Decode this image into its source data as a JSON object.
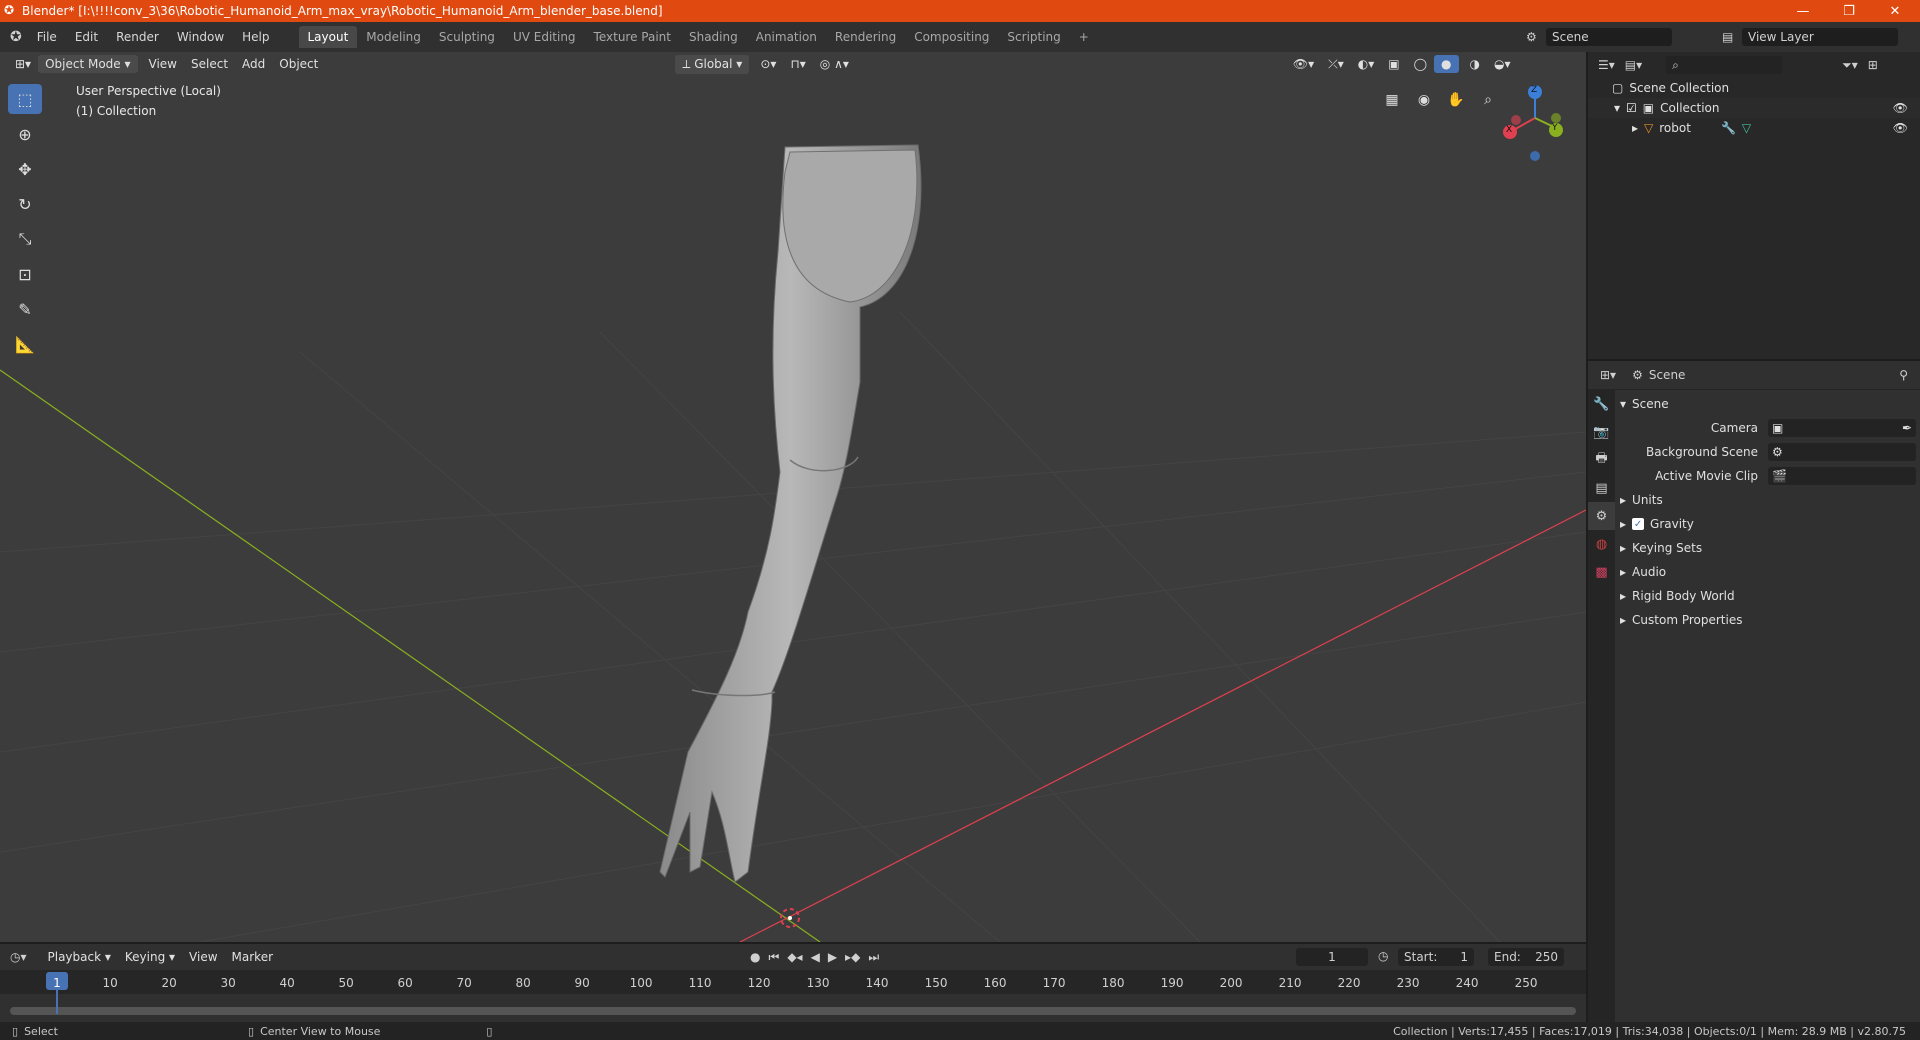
{
  "titlebar": {
    "title": "Blender* [I:\\!!!!conv_3\\36\\Robotic_Humanoid_Arm_max_vray\\Robotic_Humanoid_Arm_blender_base.blend]",
    "minimize": "—",
    "maximize": "❐",
    "close": "✕"
  },
  "menubar": {
    "menus": [
      "File",
      "Edit",
      "Render",
      "Window",
      "Help"
    ],
    "workspaces": [
      "Layout",
      "Modeling",
      "Sculpting",
      "UV Editing",
      "Texture Paint",
      "Shading",
      "Animation",
      "Rendering",
      "Compositing",
      "Scripting"
    ],
    "add_tab": "+",
    "scene_label": "Scene",
    "view_layer_label": "View Layer"
  },
  "viewport": {
    "mode": "Object Mode",
    "menus": [
      "View",
      "Select",
      "Add",
      "Object"
    ],
    "orientation": "Global",
    "perspective_label": "User Perspective (Local)",
    "collection_label": "(1) Collection",
    "gizmo": {
      "x": "X",
      "y": "Y",
      "z": "Z"
    }
  },
  "outliner": {
    "root": "Scene Collection",
    "collection": "Collection",
    "object": "robot"
  },
  "properties": {
    "context": "Scene",
    "panel_title": "Scene",
    "camera_label": "Camera",
    "bg_scene_label": "Background Scene",
    "movie_clip_label": "Active Movie Clip",
    "sections": [
      "Units",
      "Gravity",
      "Keying Sets",
      "Audio",
      "Rigid Body World",
      "Custom Properties"
    ]
  },
  "timeline": {
    "menus": [
      "Playback",
      "Keying",
      "View",
      "Marker"
    ],
    "current_frame": "1",
    "start_label": "Start:",
    "start": "1",
    "end_label": "End:",
    "end": "250",
    "ticks": [
      "1",
      "10",
      "20",
      "30",
      "40",
      "50",
      "60",
      "70",
      "80",
      "90",
      "100",
      "110",
      "120",
      "130",
      "140",
      "150",
      "160",
      "170",
      "180",
      "190",
      "200",
      "210",
      "220",
      "230",
      "240",
      "250"
    ]
  },
  "statusbar": {
    "select": "Select",
    "center_view": "Center View to Mouse",
    "stats": "Collection | Verts:17,455 | Faces:17,019 | Tris:34,038 | Objects:0/1 | Mem: 28.9 MB | v2.80.75"
  },
  "colors": {
    "accent": "#4772b3",
    "titlebar": "#e04a10",
    "x_axis": "#e04050",
    "y_axis": "#8ab020",
    "z_axis": "#3b7fd8"
  }
}
